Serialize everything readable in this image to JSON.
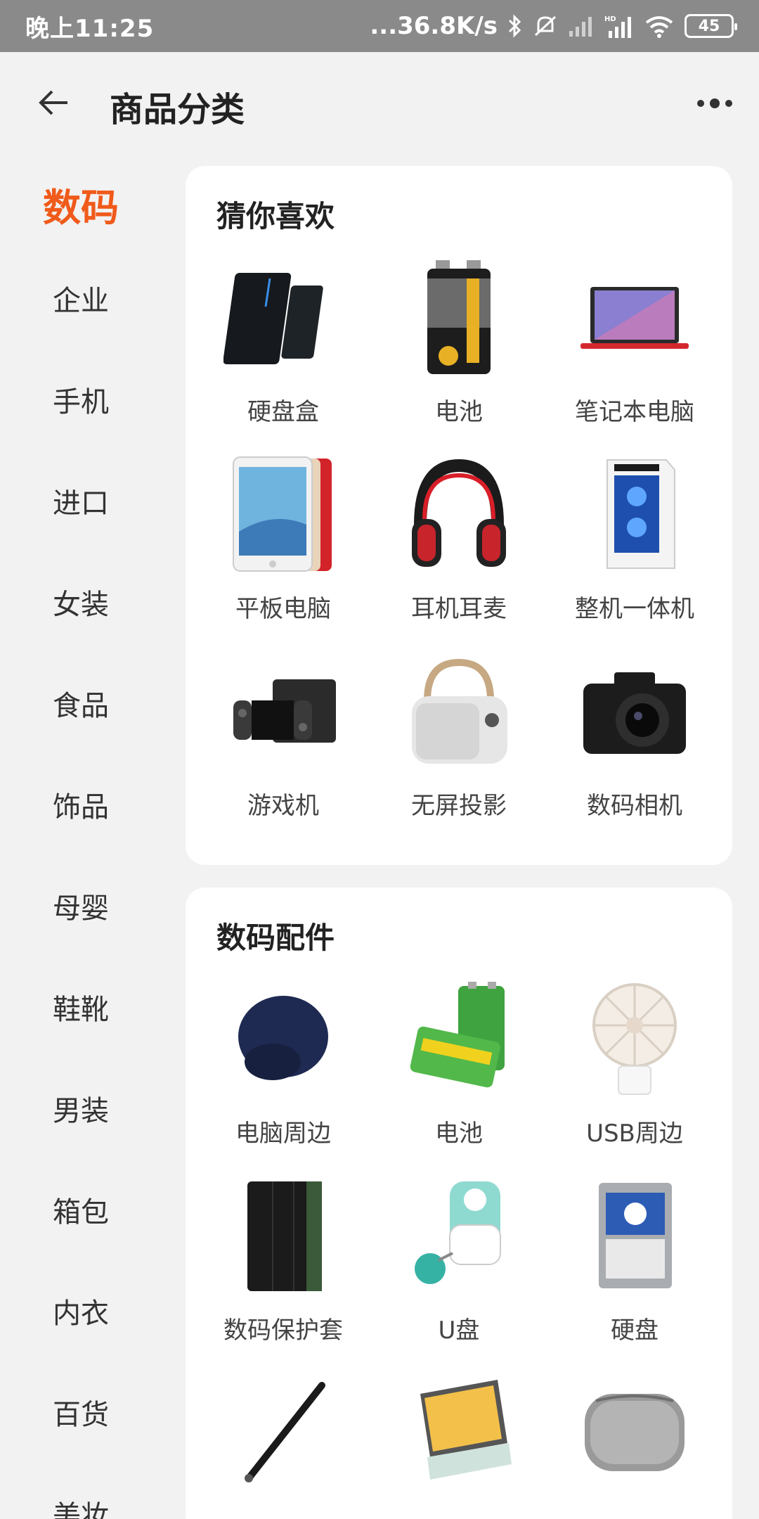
{
  "status_bar": {
    "time": "晚上11:25",
    "network_speed": "...36.8K/s",
    "battery": "45",
    "icons": [
      "bluetooth-icon",
      "mute-icon",
      "signal-icon",
      "hd-signal-icon",
      "wifi-icon",
      "battery-icon"
    ]
  },
  "header": {
    "title": "商品分类",
    "back_icon": "arrow-left-icon",
    "more_icon": "more-dots-icon"
  },
  "colors": {
    "accent": "#f05a1a",
    "background": "#f2f2f2",
    "card": "#ffffff",
    "status_bar": "#8a8a8a"
  },
  "sidebar": {
    "items": [
      {
        "label": "数码",
        "active": true
      },
      {
        "label": "企业"
      },
      {
        "label": "手机"
      },
      {
        "label": "进口"
      },
      {
        "label": "女装"
      },
      {
        "label": "食品"
      },
      {
        "label": "饰品"
      },
      {
        "label": "母婴"
      },
      {
        "label": "鞋靴"
      },
      {
        "label": "男装"
      },
      {
        "label": "箱包"
      },
      {
        "label": "内衣"
      },
      {
        "label": "百货"
      },
      {
        "label": "美妆"
      }
    ]
  },
  "sections": [
    {
      "title": "猜你喜欢",
      "items": [
        {
          "label": "硬盘盒",
          "icon": "hdd-enclosure-icon"
        },
        {
          "label": "电池",
          "icon": "battery-9v-icon"
        },
        {
          "label": "笔记本电脑",
          "icon": "laptop-icon"
        },
        {
          "label": "平板电脑",
          "icon": "tablet-icon"
        },
        {
          "label": "耳机耳麦",
          "icon": "headphones-icon"
        },
        {
          "label": "整机一体机",
          "icon": "desktop-tower-icon"
        },
        {
          "label": "游戏机",
          "icon": "game-console-icon"
        },
        {
          "label": "无屏投影",
          "icon": "projector-icon"
        },
        {
          "label": "数码相机",
          "icon": "camera-icon"
        }
      ]
    },
    {
      "title": "数码配件",
      "items": [
        {
          "label": "电脑周边",
          "icon": "mousepad-icon"
        },
        {
          "label": "电池",
          "icon": "battery-icon"
        },
        {
          "label": "USB周边",
          "icon": "usb-fan-icon"
        },
        {
          "label": "数码保护套",
          "icon": "tablet-case-icon"
        },
        {
          "label": "U盘",
          "icon": "usb-drive-icon"
        },
        {
          "label": "硬盘",
          "icon": "hard-drive-icon"
        },
        {
          "label": "",
          "icon": "stylus-pen-icon"
        },
        {
          "label": "",
          "icon": "keyboard-cover-icon"
        },
        {
          "label": "",
          "icon": "storage-case-icon"
        }
      ]
    }
  ]
}
